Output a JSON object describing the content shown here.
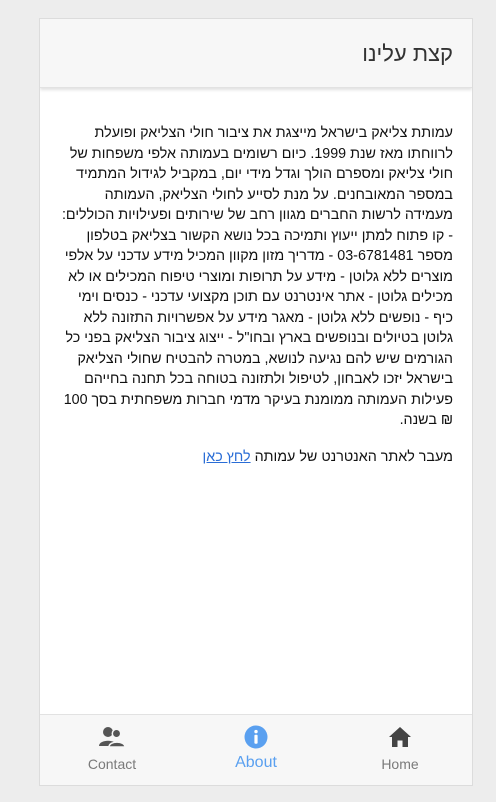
{
  "header": {
    "title": "קצת עלינו"
  },
  "about": {
    "paragraph": "עמותת צליאק בישראל מייצגת את ציבור חולי הצליאק ופועלת לרווחתו מאז שנת 1999. כיום רשומים בעמותה אלפי משפחות של חולי צליאק ומספרם הולך וגדל מידי יום, במקביל לגידול המתמיד במספר המאובחנים. על מנת לסייע לחולי הצליאק, העמותה מעמידה לרשות החברים מגוון רחב של שירותים ופעילויות הכוללים: - קו פתוח למתן ייעוץ ותמיכה בכל נושא הקשור בצליאק בטלפון מספר 03-6781481 - מדריך מזון מקוון המכיל מידע עדכני על אלפי מוצרים ללא גלוטן - מידע על תרופות ומוצרי טיפוח המכילים או לא מכילים גלוטן - אתר אינטרנט עם תוכן מקצועי עדכני - כנסים וימי כיף - נופשים ללא גלוטן - מאגר מידע על אפשרויות התזונה ללא גלוטן בטיולים ובנופשים בארץ ובחו\"ל - ייצוג ציבור הצליאק בפני כל הגורמים שיש להם נגיעה לנושא, במטרה להבטיח שחולי הצליאק בישראל יזכו לאבחון, לטיפול ולתזונה בטוחה בכל תחנה בחייהם פעילות העמותה ממומנת בעיקר מדמי חברות משפחתית בסך 100 ₪ בשנה.",
    "website_text": "מעבר לאתר האנטרנט של עמותה ",
    "website_link": "לחץ כאן"
  },
  "tabs": {
    "contact": {
      "label": "Contact",
      "icon": "contacts-icon"
    },
    "about": {
      "label": "About",
      "icon": "info-icon"
    },
    "home": {
      "label": "Home",
      "icon": "home-icon"
    }
  },
  "colors": {
    "active_tab": "#5aa0f0",
    "inactive_tab": "#7a7a7a",
    "link": "#2a6dd6"
  }
}
